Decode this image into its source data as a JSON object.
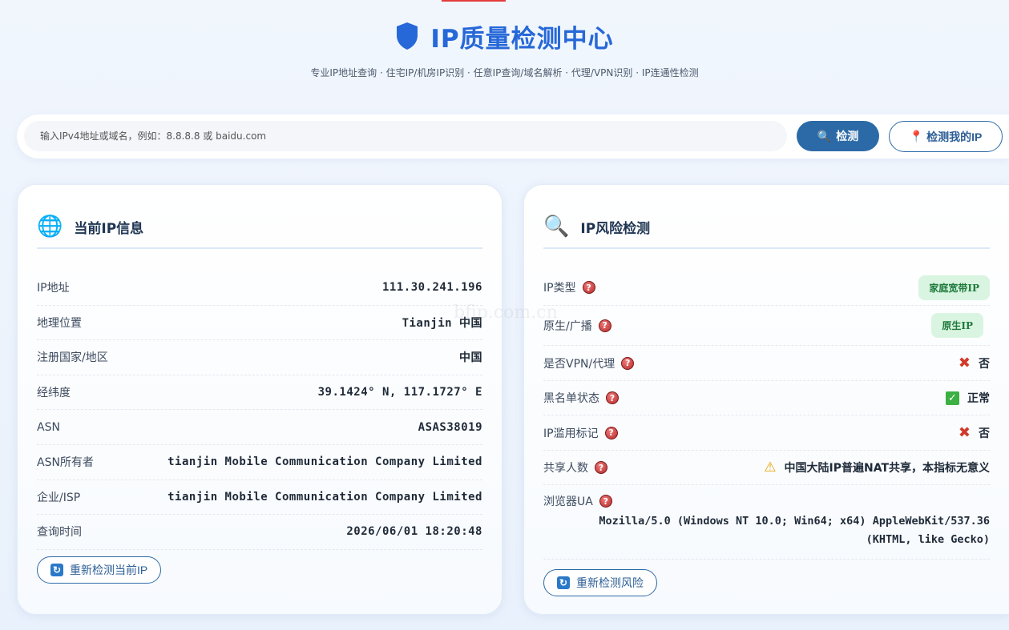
{
  "header": {
    "title": "IP质量检测中心",
    "subtitle": "专业IP地址查询 · 住宅IP/机房IP识别 · 任意IP查询/域名解析 · 代理/VPN识别 · IP连通性检测"
  },
  "search": {
    "placeholder": "输入IPv4地址或域名，例如：8.8.8.8 或 baidu.com",
    "detect_label": "检测",
    "myip_label": "检测我的IP"
  },
  "ip_info": {
    "title": "当前IP信息",
    "rows": [
      {
        "label": "IP地址",
        "value": "111.30.241.196"
      },
      {
        "label": "地理位置",
        "value": "Tianjin 中国"
      },
      {
        "label": "注册国家/地区",
        "value": "中国"
      },
      {
        "label": "经纬度",
        "value": "39.1424° N, 117.1727° E"
      },
      {
        "label": "ASN",
        "value": "ASAS38019"
      },
      {
        "label": "ASN所有者",
        "value": "tianjin Mobile Communication Company Limited"
      },
      {
        "label": "企业/ISP",
        "value": "tianjin Mobile Communication Company Limited"
      },
      {
        "label": "查询时间",
        "value": "2026/06/01 18:20:48"
      }
    ],
    "refresh_label": "重新检测当前IP"
  },
  "risk": {
    "title": "IP风险检测",
    "ip_type": {
      "label": "IP类型",
      "value": "家庭宽带IP"
    },
    "native": {
      "label": "原生/广播",
      "value": "原生IP"
    },
    "vpn": {
      "label": "是否VPN/代理",
      "value": "否"
    },
    "blacklist": {
      "label": "黑名单状态",
      "value": "正常"
    },
    "abuse": {
      "label": "IP滥用标记",
      "value": "否"
    },
    "shared": {
      "label": "共享人数",
      "value": "中国大陆IP普遍NAT共享，本指标无意义"
    },
    "ua": {
      "label": "浏览器UA",
      "value_line1": "Mozilla/5.0 (Windows NT 10.0; Win64; x64) AppleWebKit/537.36",
      "value_line2": "(KHTML, like Gecko)"
    },
    "refresh_label": "重新检测风险"
  },
  "watermark": "bfip.com.cn",
  "colors": {
    "accent": "#2668d8",
    "button": "#2c6aa7",
    "badge_bg": "#d9f5e1",
    "badge_text": "#1f7a3c"
  }
}
